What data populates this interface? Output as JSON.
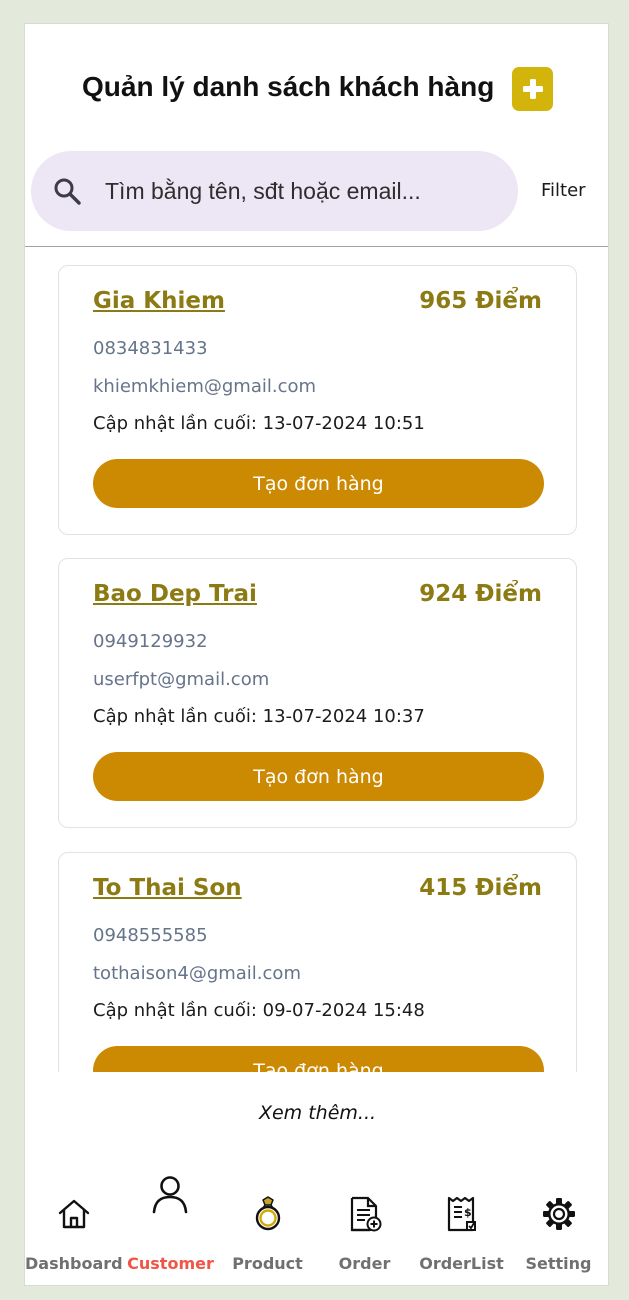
{
  "header": {
    "title": "Quản lý danh sách khách hàng",
    "add_icon": "plus-icon"
  },
  "search": {
    "placeholder": "Tìm bằng tên, sđt hoặc email...",
    "value": ""
  },
  "filter_label": "Filter",
  "colors": {
    "accent_gold": "#8c7a12",
    "button": "#cc8a03",
    "add_button": "#d2b40a",
    "nav_active": "#f05545",
    "search_bg": "#ede6f4"
  },
  "customers": [
    {
      "name": "Gia Khiem",
      "points": "965 Điểm",
      "phone": "0834831433",
      "email": "khiemkhiem@gmail.com",
      "updated": "Cập nhật lần cuối: 13-07-2024 10:51",
      "button": "Tạo đơn hàng"
    },
    {
      "name": "Bao Dep Trai",
      "points": "924 Điểm",
      "phone": "0949129932",
      "email": "userfpt@gmail.com",
      "updated": "Cập nhật lần cuối: 13-07-2024 10:37",
      "button": "Tạo đơn hàng"
    },
    {
      "name": "To Thai Son",
      "points": "415 Điểm",
      "phone": "0948555585",
      "email": "tothaison4@gmail.com",
      "updated": "Cập nhật lần cuối: 09-07-2024 15:48",
      "button": "Tạo đơn hàng"
    }
  ],
  "see_more": "Xem thêm...",
  "nav": [
    {
      "label": "Dashboard",
      "icon": "home-icon",
      "active": false
    },
    {
      "label": "Customer",
      "icon": "user-icon",
      "active": true
    },
    {
      "label": "Product",
      "icon": "ring-icon",
      "active": false
    },
    {
      "label": "Order",
      "icon": "document-add-icon",
      "active": false
    },
    {
      "label": "OrderList",
      "icon": "receipt-icon",
      "active": false
    },
    {
      "label": "Setting",
      "icon": "gear-icon",
      "active": false
    }
  ]
}
